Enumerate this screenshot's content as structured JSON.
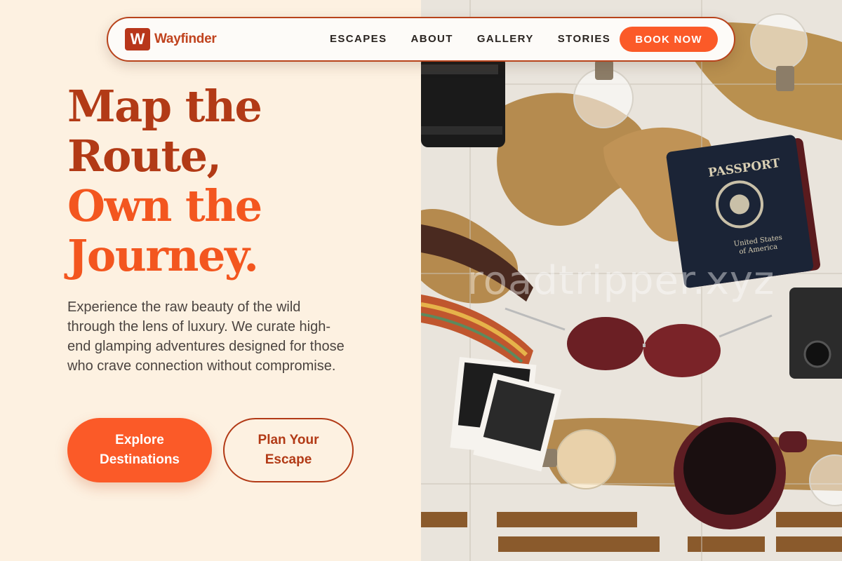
{
  "brand": {
    "mark": "W",
    "name": "Wayfinder",
    "accent": "#fb5a28",
    "dark_accent": "#b23a16"
  },
  "nav": {
    "links": [
      "ESCAPES",
      "ABOUT",
      "GALLERY",
      "STORIES"
    ],
    "cta": "BOOK NOW"
  },
  "hero": {
    "title_line1": "Map the",
    "title_line2": "Route,",
    "title_line3": "Own the",
    "title_line4": "Journey.",
    "body": "Experience the raw beauty of the wild through the lens of luxury. We curate high-end glamping adventures designed for those who crave connection without compromise.",
    "primary_line1": "Explore",
    "primary_line2": "Destinations",
    "secondary_line1": "Plan Your",
    "secondary_line2": "Escape"
  },
  "photo": {
    "watermark": "roadtripper.xyz",
    "passport_title": "PASSPORT",
    "passport_country_line1": "United States",
    "passport_country_line2": "of America"
  }
}
